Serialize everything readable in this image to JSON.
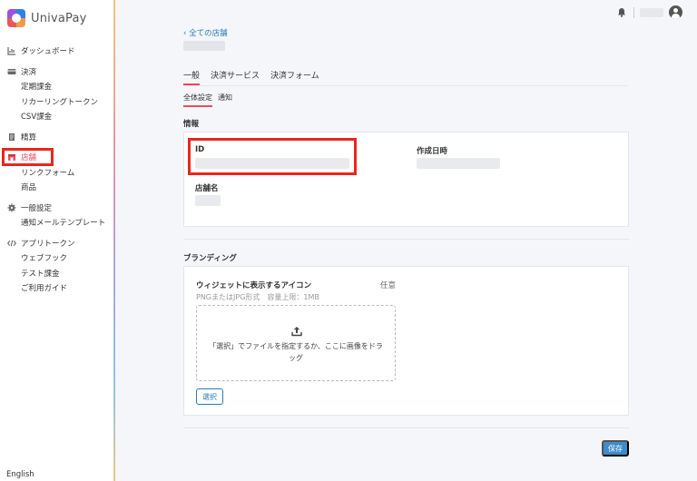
{
  "app": {
    "name": "UnivaPay"
  },
  "sidebar": {
    "groups": [
      {
        "items": [
          {
            "label": "ダッシュボード",
            "icon": "chart-icon"
          }
        ]
      },
      {
        "items": [
          {
            "label": "決済",
            "icon": "card-icon"
          },
          {
            "label": "定期課金"
          },
          {
            "label": "リカーリングトークン"
          },
          {
            "label": "CSV課金"
          }
        ]
      },
      {
        "items": [
          {
            "label": "精算",
            "icon": "document-icon"
          }
        ]
      },
      {
        "items": [
          {
            "label": "店舗",
            "icon": "store-icon",
            "active": true
          },
          {
            "label": "リンクフォーム"
          },
          {
            "label": "商品"
          }
        ]
      },
      {
        "items": [
          {
            "label": "一般設定",
            "icon": "gear-icon"
          },
          {
            "label": "通知メールテンプレート"
          }
        ]
      },
      {
        "items": [
          {
            "label": "アプリトークン",
            "icon": "code-icon"
          },
          {
            "label": "ウェブフック"
          },
          {
            "label": "テスト課金"
          },
          {
            "label": "ご利用ガイド"
          }
        ]
      }
    ],
    "language": "English"
  },
  "header": {
    "back_link": "‹ 全ての店舗"
  },
  "tabs": [
    "一般",
    "決済サービス",
    "決済フォーム"
  ],
  "subtabs": [
    "全体設定",
    "通知"
  ],
  "info": {
    "section_title": "情報",
    "id_label": "ID",
    "created_label": "作成日時",
    "store_name_label": "店舗名"
  },
  "branding": {
    "section_title": "ブランディング",
    "widget_icon_title": "ウィジェットに表示するアイコン",
    "optional": "任意",
    "hint": "PNGまたはJPG形式　容量上限：1MB",
    "dropzone_text": "「選択」でファイルを指定するか、ここに画像をドラッグ",
    "select_label": "選択"
  },
  "save_label": "保存",
  "colors": {
    "accent": "#e84a5f",
    "link": "#2a7ab8",
    "primary_button": "#3f8cc8",
    "highlight": "#e8271e"
  }
}
